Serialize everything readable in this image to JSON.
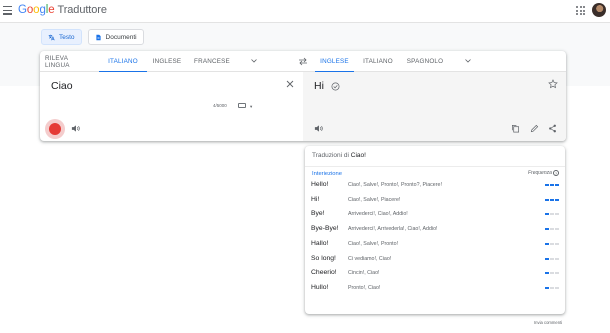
{
  "header": {
    "logo_letters": [
      "G",
      "o",
      "o",
      "g",
      "l",
      "e"
    ],
    "product": "Traduttore"
  },
  "modes": [
    {
      "label": "Testo",
      "icon": "translate-icon",
      "active": true
    },
    {
      "label": "Documenti",
      "icon": "document-icon",
      "active": false
    }
  ],
  "source_langs": [
    "RILEVA LINGUA",
    "ITALIANO",
    "INGLESE",
    "FRANCESE"
  ],
  "source_active": "ITALIANO",
  "target_langs": [
    "INGLESE",
    "ITALIANO",
    "SPAGNOLO"
  ],
  "target_active": "INGLESE",
  "source": {
    "text": "Ciao",
    "char_count": "4/5000"
  },
  "target": {
    "text": "Hi"
  },
  "dictionary": {
    "title_prefix": "Traduzioni di",
    "title_word": "Ciao!",
    "part_of_speech": "Interiezione",
    "frequency_label": "Frequenza",
    "frequency_help": "?",
    "rows": [
      {
        "word": "Hello!",
        "synonyms": "Ciao!, Salve!, Pronto!, Pronto?, Piacere!",
        "frequency": 3
      },
      {
        "word": "Hi!",
        "synonyms": "Ciao!, Salve!, Piacere!",
        "frequency": 3
      },
      {
        "word": "Bye!",
        "synonyms": "Arrivederci!, Ciao!, Addio!",
        "frequency": 1
      },
      {
        "word": "Bye-Bye!",
        "synonyms": "Arrivederci!, Arrivederla!, Ciao!, Addio!",
        "frequency": 1
      },
      {
        "word": "Hallo!",
        "synonyms": "Ciao!, Salve!, Pronto!",
        "frequency": 1
      },
      {
        "word": "So long!",
        "synonyms": "Ci vediamo!, Ciao!",
        "frequency": 1
      },
      {
        "word": "Cheerio!",
        "synonyms": "Cincin!, Ciao!",
        "frequency": 1
      },
      {
        "word": "Hullo!",
        "synonyms": "Pronto!, Ciao!",
        "frequency": 1
      }
    ]
  },
  "feedback": "Invia commenti",
  "colors": {
    "accent": "#1a73e8",
    "record": "#e53935"
  }
}
